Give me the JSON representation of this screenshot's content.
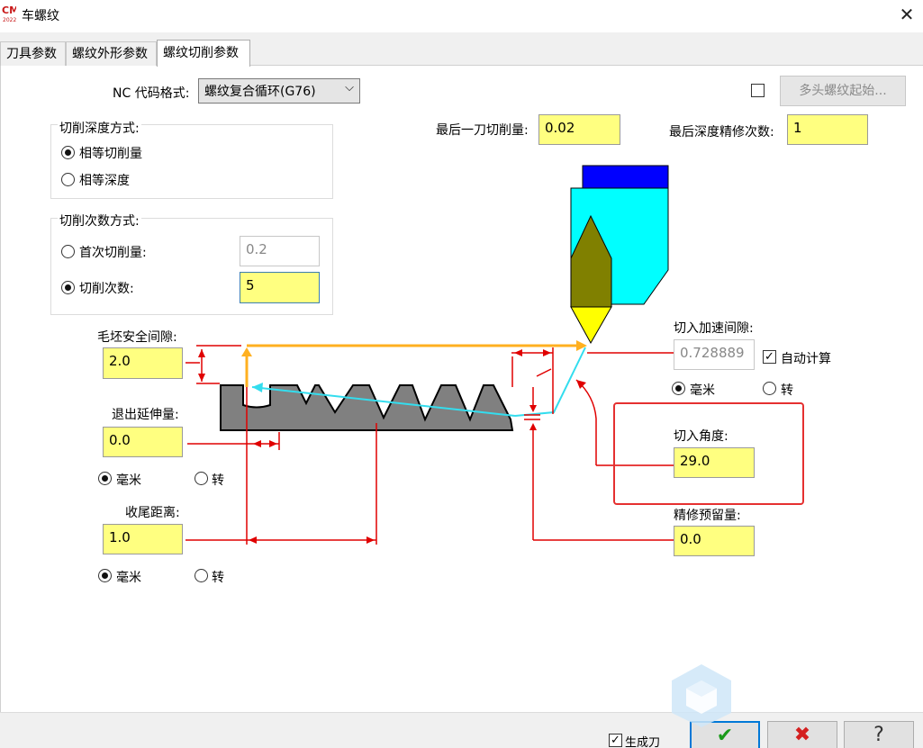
{
  "window": {
    "title": "车螺纹",
    "logo_text": "2022",
    "close_glyph": "✕"
  },
  "tabs": [
    {
      "label": "刀具参数",
      "active": false
    },
    {
      "label": "螺纹外形参数",
      "active": false
    },
    {
      "label": "螺纹切削参数",
      "active": true
    }
  ],
  "nc": {
    "label": "NC 代码格式:",
    "value": "螺纹复合循环(G76)",
    "arrow": "⌵"
  },
  "multi_start": {
    "checked": false,
    "button_label": "多头螺纹起始..."
  },
  "depth_mode": {
    "title": "切削深度方式:",
    "options": [
      {
        "label": "相等切削量",
        "selected": true
      },
      {
        "label": "相等深度",
        "selected": false
      }
    ]
  },
  "count_mode": {
    "title": "切削次数方式:",
    "first_cut_label": "首次切削量:",
    "first_cut_value": "0.2",
    "cuts_label": "切削次数:",
    "cuts_value": "5",
    "selected": "cuts"
  },
  "last_cut": {
    "label": "最后一刀切削量:",
    "value": "0.02"
  },
  "finish_passes": {
    "label": "最后深度精修次数:",
    "value": "1"
  },
  "blank_clearance": {
    "label": "毛坯安全间隙:",
    "value": "2.0"
  },
  "exit_extension": {
    "label": "退出延伸量:",
    "value": "0.0",
    "unit_mm": "毫米",
    "unit_rev": "转",
    "selected_unit": "mm"
  },
  "tail_distance": {
    "label": "收尾距离:",
    "value": "1.0",
    "unit_mm": "毫米",
    "unit_rev": "转",
    "selected_unit": "mm"
  },
  "accel_gap": {
    "label": "切入加速间隙:",
    "value": "0.728889",
    "auto_label": "自动计算",
    "auto_checked": true,
    "unit_mm": "毫米",
    "unit_rev": "转",
    "selected_unit": "mm"
  },
  "infeed_angle": {
    "label": "切入角度:",
    "value": "29.0"
  },
  "finish_allowance": {
    "label": "精修预留量:",
    "value": "0.0"
  },
  "footer": {
    "generate_label": "生成刀",
    "generate_checked": true,
    "ok_glyph": "✔",
    "cancel_glyph": "✖",
    "help_glyph": "?"
  },
  "colors": {
    "field_yellow": "#ffff80",
    "highlight_red": "#e53030",
    "tool_cyan": "#00ffff",
    "tool_blue": "#0000ff",
    "insert_olive": "#808000",
    "tip_yellow": "#ffff00",
    "path_orange": "#ffb020",
    "path_cyan": "#33ddee",
    "dim_red": "#e00000",
    "thread_gray": "#808080",
    "ok_green": "#1a9a1a",
    "cancel_red": "#d42020"
  }
}
